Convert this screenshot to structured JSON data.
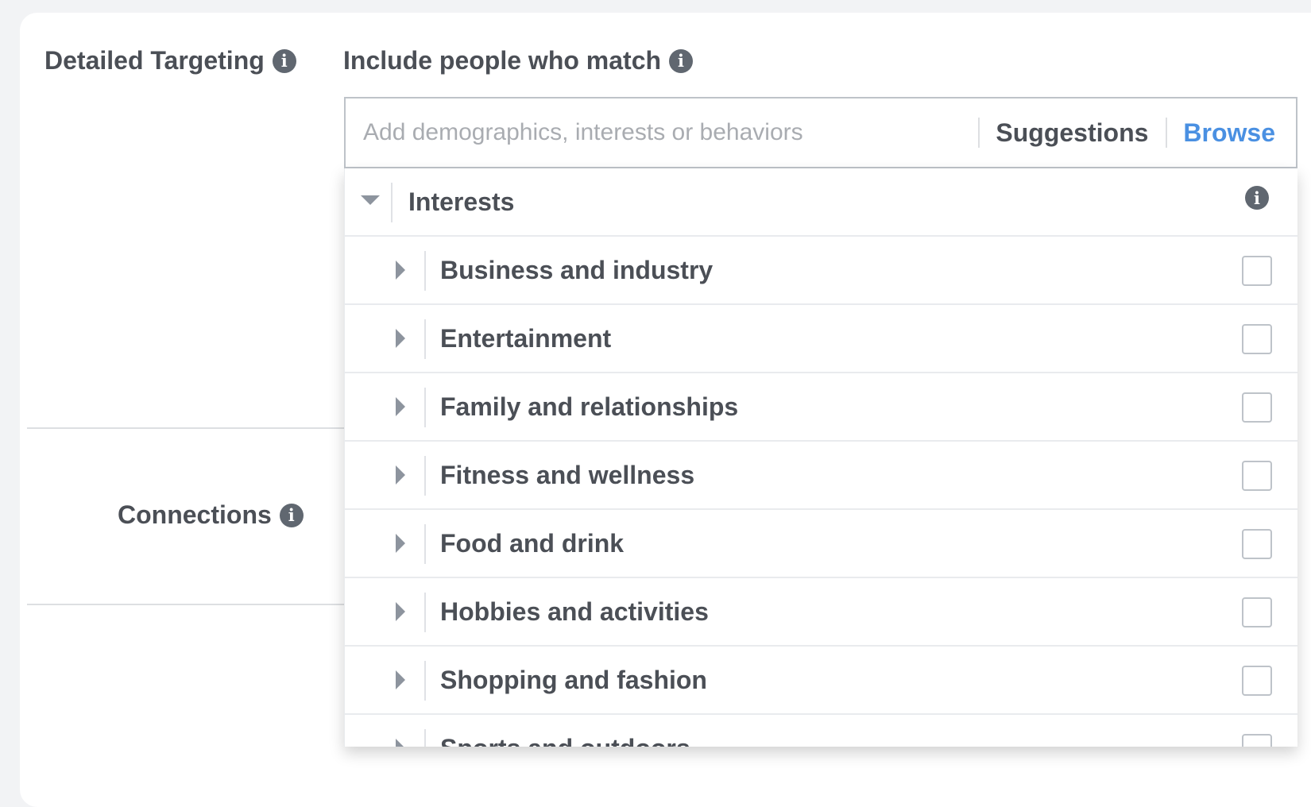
{
  "detailed_targeting": {
    "label": "Detailed Targeting",
    "include_label": "Include people who match"
  },
  "search": {
    "placeholder": "Add demographics, interests or behaviors",
    "suggestions_label": "Suggestions",
    "browse_label": "Browse"
  },
  "dropdown": {
    "header": "Interests",
    "items": [
      {
        "label": "Business and industry",
        "checked": false
      },
      {
        "label": "Entertainment",
        "checked": false
      },
      {
        "label": "Family and relationships",
        "checked": false
      },
      {
        "label": "Fitness and wellness",
        "checked": false
      },
      {
        "label": "Food and drink",
        "checked": false
      },
      {
        "label": "Hobbies and activities",
        "checked": false
      },
      {
        "label": "Shopping and fashion",
        "checked": false
      },
      {
        "label": "Sports and outdoors",
        "checked": false
      }
    ]
  },
  "connections": {
    "label": "Connections"
  },
  "icons": {
    "info": "info-icon",
    "expand": "caret-right-icon",
    "collapse": "caret-down-icon"
  },
  "colors": {
    "accent": "#4a90e2",
    "text": "#4b4f56",
    "placeholder": "#a9acb1"
  }
}
